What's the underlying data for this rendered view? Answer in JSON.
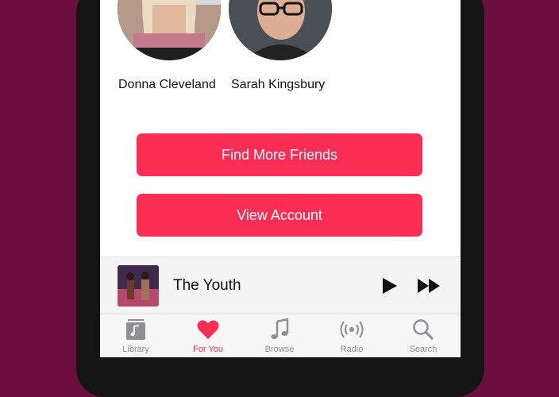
{
  "friends": [
    {
      "name": "Donna Cleveland"
    },
    {
      "name": "Sarah Kingsbury"
    }
  ],
  "buttons": {
    "find_friends": "Find More Friends",
    "view_account": "View Account"
  },
  "now_playing": {
    "title": "The Youth"
  },
  "tabs": [
    {
      "label": "Library",
      "icon": "library-icon"
    },
    {
      "label": "For You",
      "icon": "heart-icon",
      "active": true
    },
    {
      "label": "Browse",
      "icon": "music-note-icon"
    },
    {
      "label": "Radio",
      "icon": "radio-icon"
    },
    {
      "label": "Search",
      "icon": "search-icon"
    }
  ],
  "colors": {
    "accent": "#fa2d55",
    "background": "#6b0f3e"
  }
}
